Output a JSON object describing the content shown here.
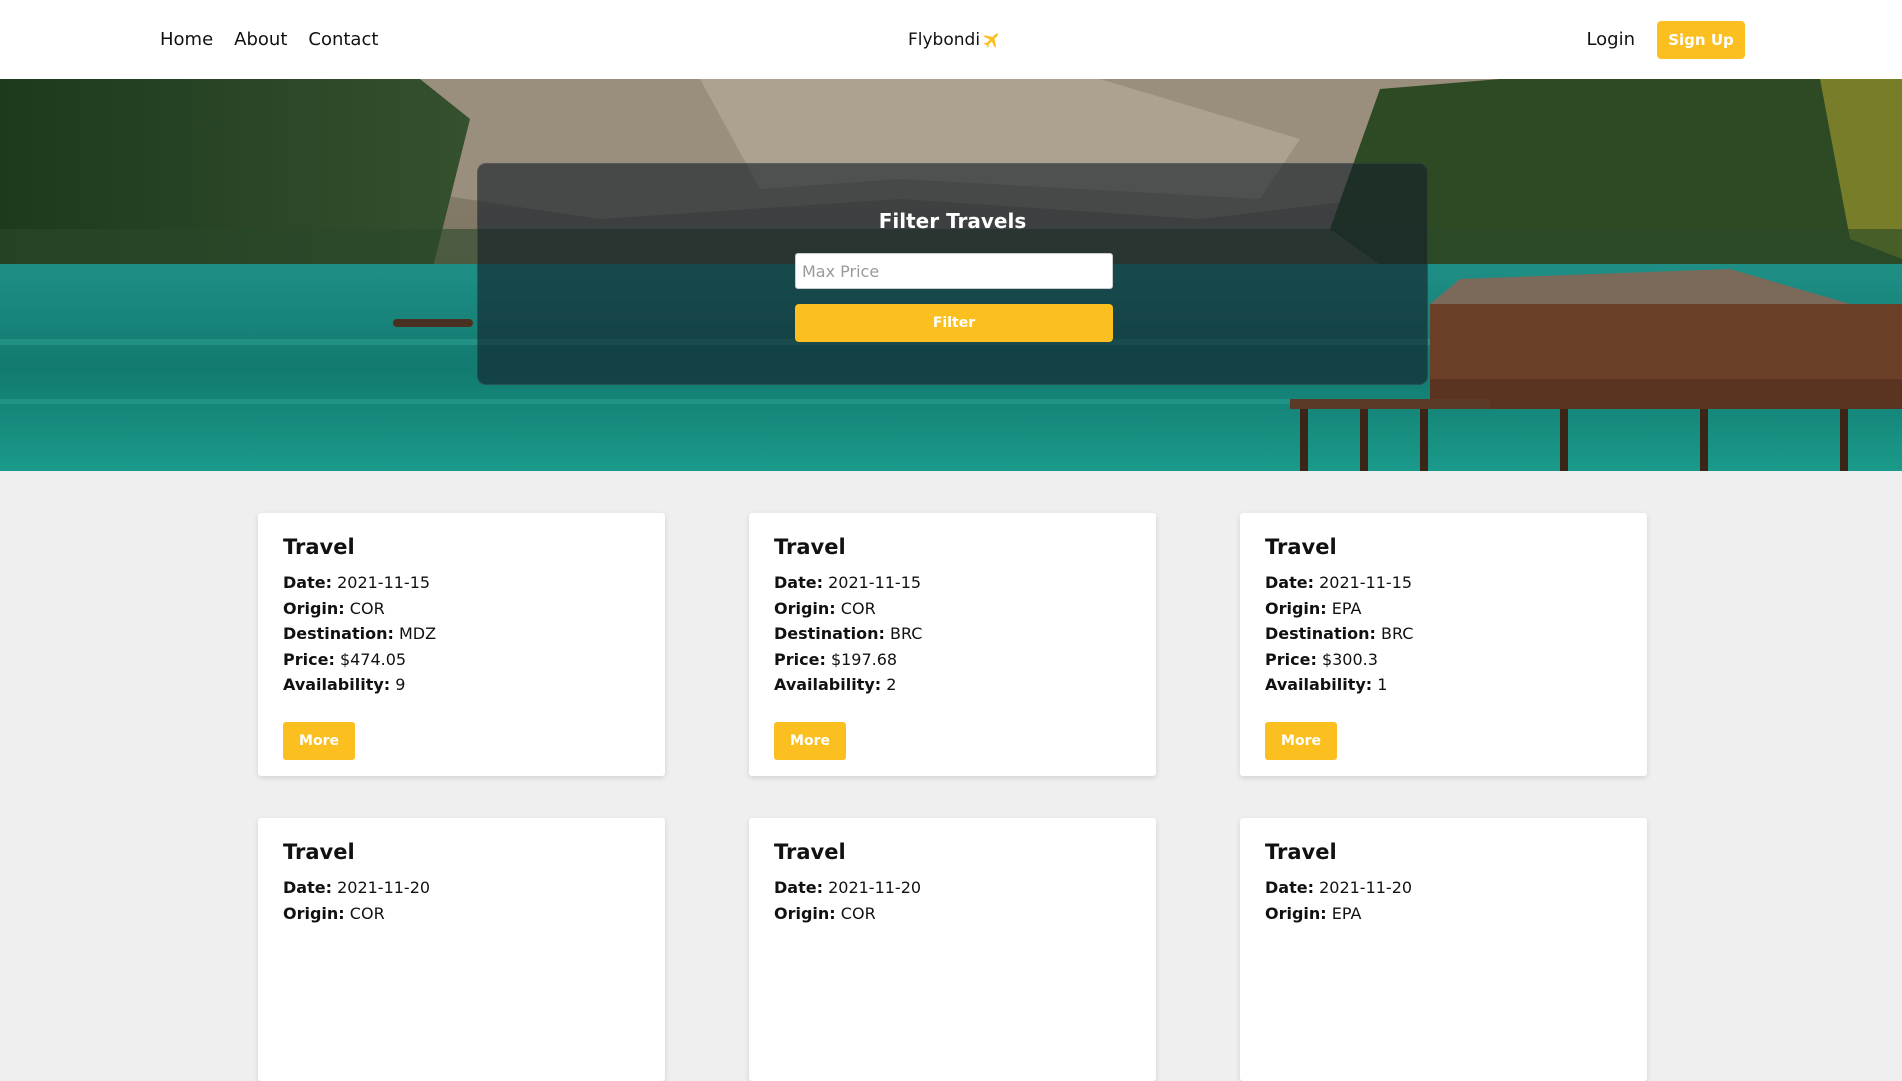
{
  "header": {
    "nav": [
      {
        "label": "Home"
      },
      {
        "label": "About"
      },
      {
        "label": "Contact"
      }
    ],
    "brand": "Flybondi",
    "login_label": "Login",
    "signup_label": "Sign Up"
  },
  "filter": {
    "title": "Filter Travels",
    "placeholder": "Max Price",
    "value": "",
    "button_label": "Filter"
  },
  "cards": [
    {
      "title": "Travel",
      "date_label": "Date:",
      "date": "2021-11-15",
      "origin_label": "Origin:",
      "origin": "COR",
      "destination_label": "Destination:",
      "destination": "MDZ",
      "price_label": "Price:",
      "price": "$474.05",
      "availability_label": "Availability:",
      "availability": "9",
      "button_label": "More"
    },
    {
      "title": "Travel",
      "date_label": "Date:",
      "date": "2021-11-15",
      "origin_label": "Origin:",
      "origin": "COR",
      "destination_label": "Destination:",
      "destination": "BRC",
      "price_label": "Price:",
      "price": "$197.68",
      "availability_label": "Availability:",
      "availability": "2",
      "button_label": "More"
    },
    {
      "title": "Travel",
      "date_label": "Date:",
      "date": "2021-11-15",
      "origin_label": "Origin:",
      "origin": "EPA",
      "destination_label": "Destination:",
      "destination": "BRC",
      "price_label": "Price:",
      "price": "$300.3",
      "availability_label": "Availability:",
      "availability": "1",
      "button_label": "More"
    },
    {
      "title": "Travel",
      "date_label": "Date:",
      "date": "2021-11-20",
      "origin_label": "Origin:",
      "origin": "COR"
    },
    {
      "title": "Travel",
      "date_label": "Date:",
      "date": "2021-11-20",
      "origin_label": "Origin:",
      "origin": "COR"
    },
    {
      "title": "Travel",
      "date_label": "Date:",
      "date": "2021-11-20",
      "origin_label": "Origin:",
      "origin": "EPA"
    }
  ],
  "colors": {
    "accent": "#fbbf1f",
    "page_background": "#efefef",
    "card_background": "#ffffff"
  },
  "icons": {
    "brand_icon": "airplane-icon"
  }
}
